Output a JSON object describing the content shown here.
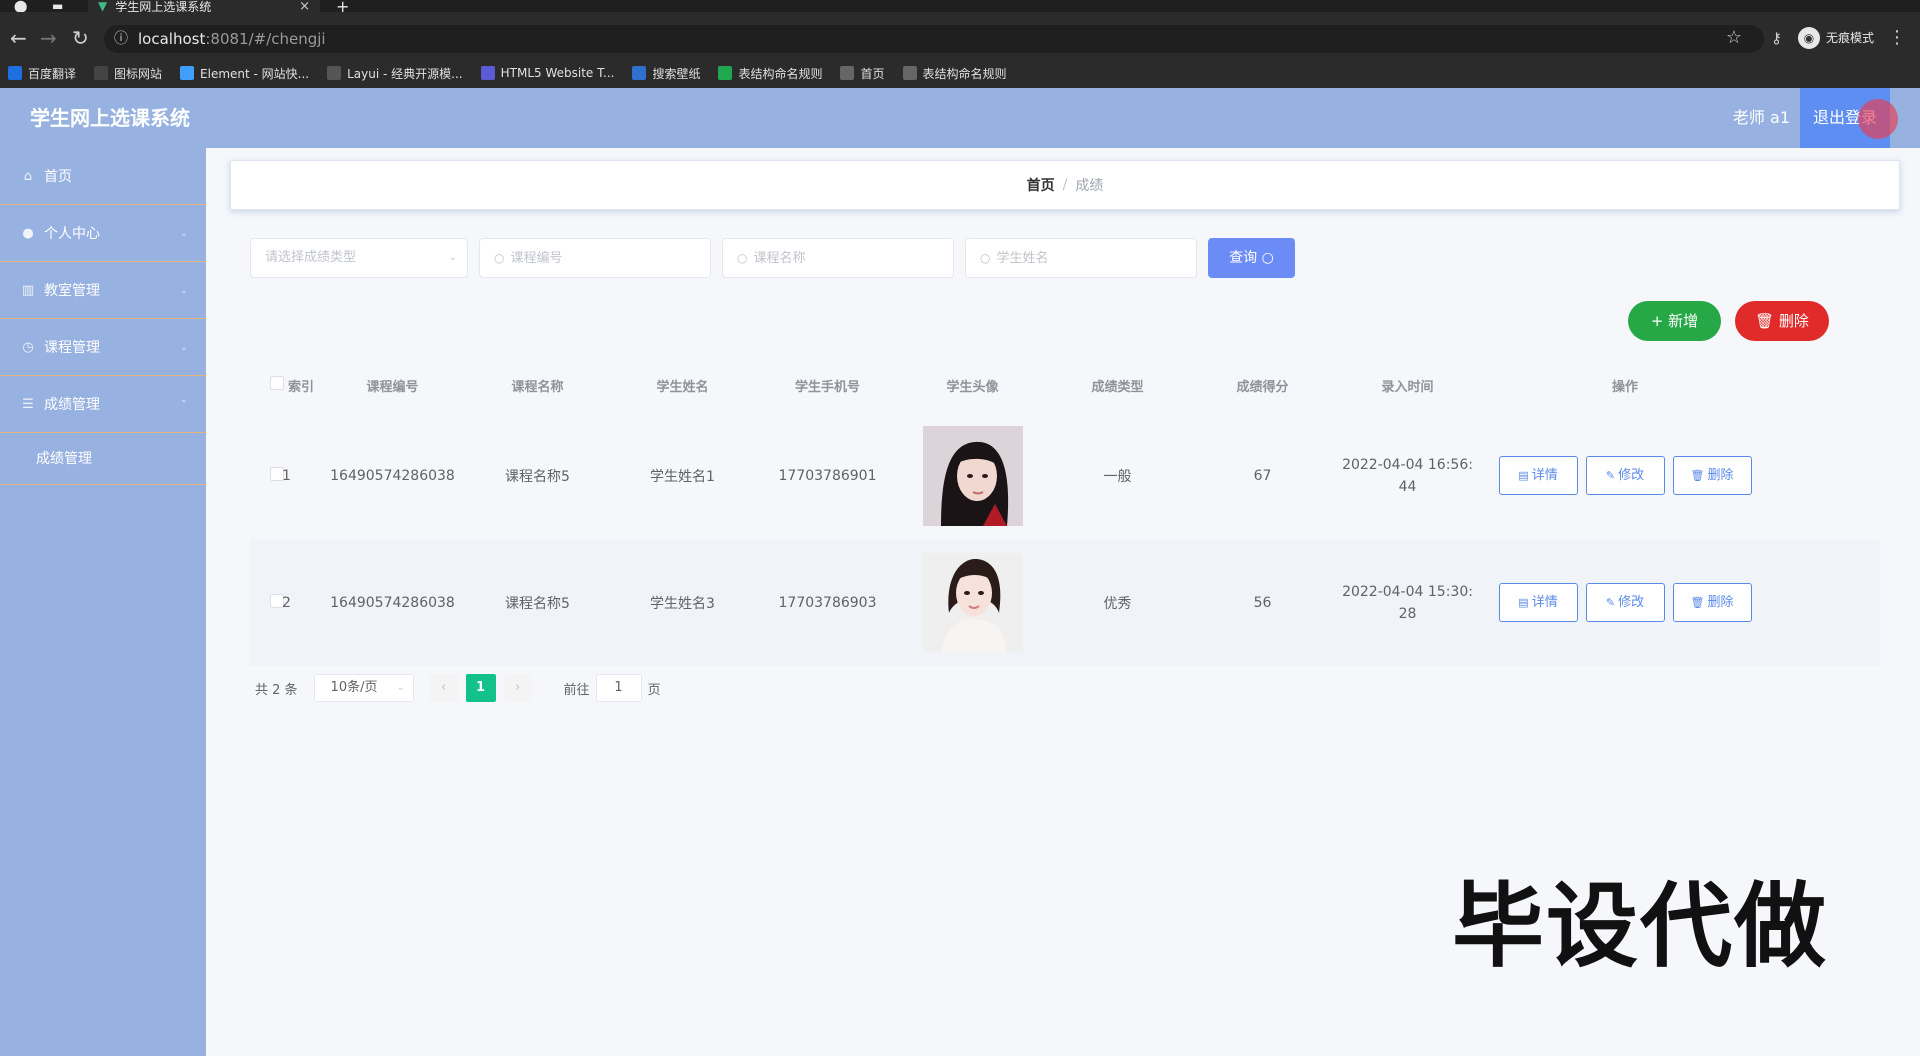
{
  "browser": {
    "tab_title": "学生网上选课系统",
    "url_host": "localhost",
    "url_path": ":8081/#/chengji",
    "incognito_label": "无痕模式",
    "bookmarks": [
      {
        "label": "百度翻译",
        "color": "#1e6fe0"
      },
      {
        "label": "图标网站",
        "color": "#444444"
      },
      {
        "label": "Element - 网站快...",
        "color": "#409eff"
      },
      {
        "label": "Layui - 经典开源模...",
        "color": "#555555"
      },
      {
        "label": "HTML5 Website T...",
        "color": "#5b5bd6"
      },
      {
        "label": "搜索壁纸",
        "color": "#2f6fd0"
      },
      {
        "label": "表结构命名规则",
        "color": "#1fa84f"
      },
      {
        "label": "首页",
        "color": "#666666"
      },
      {
        "label": "表结构命名规则",
        "color": "#666666"
      }
    ]
  },
  "header": {
    "title": "学生网上选课系统",
    "user": "老师 a1",
    "logout": "退出登录"
  },
  "sidebar": {
    "items": [
      {
        "label": "首页",
        "icon": "home-icon",
        "glyph": "⌂",
        "arrow": ""
      },
      {
        "label": "个人中心",
        "icon": "user-icon",
        "glyph": "●",
        "arrow": "⌄"
      },
      {
        "label": "教室管理",
        "icon": "chart-icon",
        "glyph": "▥",
        "arrow": "⌄"
      },
      {
        "label": "课程管理",
        "icon": "clock-icon",
        "glyph": "◷",
        "arrow": "⌄"
      },
      {
        "label": "成绩管理",
        "icon": "list-icon",
        "glyph": "☰",
        "arrow": "⌃"
      }
    ],
    "submenu": [
      "成绩管理"
    ]
  },
  "breadcrumb": {
    "home": "首页",
    "sep": "/",
    "current": "成绩"
  },
  "search": {
    "type_placeholder": "请选择成绩类型",
    "code_placeholder": "课程编号",
    "name_placeholder": "课程名称",
    "student_placeholder": "学生姓名",
    "button": "查询"
  },
  "actions": {
    "add": "新增",
    "delete": "删除"
  },
  "table": {
    "headers": [
      "索引",
      "课程编号",
      "课程名称",
      "学生姓名",
      "学生手机号",
      "学生头像",
      "成绩类型",
      "成绩得分",
      "录入时间",
      "操作"
    ],
    "rows": [
      {
        "index": "1",
        "code": "16490574286038",
        "name": "课程名称5",
        "student": "学生姓名1",
        "phone": "17703786901",
        "type": "一般",
        "score": "67",
        "time_line1": "2022-04-04 16:56:",
        "time_line2": "44"
      },
      {
        "index": "2",
        "code": "16490574286038",
        "name": "课程名称5",
        "student": "学生姓名3",
        "phone": "17703786903",
        "type": "优秀",
        "score": "56",
        "time_line1": "2022-04-04 15:30:",
        "time_line2": "28"
      }
    ],
    "ops": {
      "detail": "详情",
      "edit": "修改",
      "delete": "删除"
    }
  },
  "pagination": {
    "total": "共 2 条",
    "page_size": "10条/页",
    "current": "1",
    "goto_label": "前往",
    "goto_value": "1",
    "page_unit": "页"
  },
  "watermark": "毕设代做",
  "colors": {
    "header_bg": "#97b2e0",
    "accent": "#5f8ef2",
    "add": "#27a847",
    "delete": "#e12a2a",
    "page_active": "#13c28a"
  }
}
